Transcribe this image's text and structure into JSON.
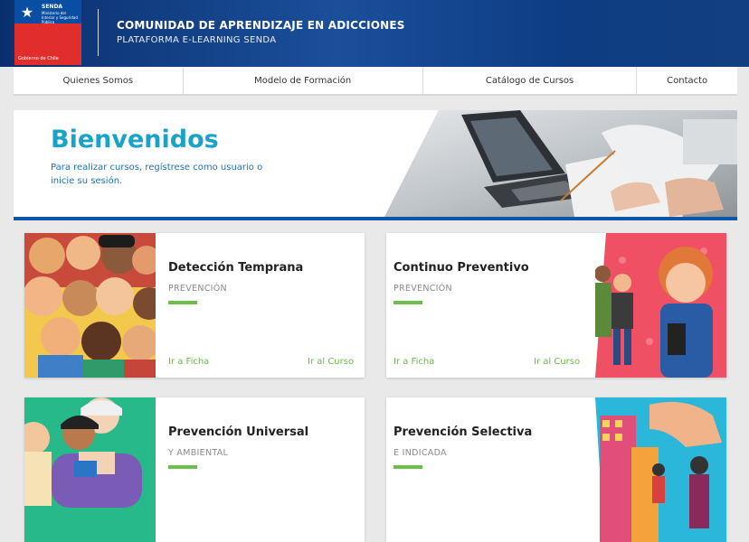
{
  "header": {
    "logo": {
      "top": "SENDA",
      "lines": "Ministerio del Interior y Seguridad Pública",
      "bottom": "Gobierno de Chile"
    },
    "title": "COMUNIDAD DE APRENDIZAJE EN ADICCIONES",
    "subtitle": "PLATAFORMA E-LEARNING SENDA"
  },
  "nav": {
    "items": [
      {
        "label": "Quienes Somos"
      },
      {
        "label": "Modelo de Formación"
      },
      {
        "label": "Catálogo de Cursos"
      },
      {
        "label": "Contacto"
      }
    ]
  },
  "banner": {
    "title": "Bienvenidos",
    "text": "Para realizar cursos, regístrese como usuario o inicie su sesión."
  },
  "cards": [
    {
      "title": "Detección Temprana",
      "category": "PREVENCIÓN",
      "link_ficha": "Ir a Ficha",
      "link_curso": "Ir al Curso"
    },
    {
      "title": "Continuo Preventivo",
      "category": "PREVENCIÓN",
      "link_ficha": "Ir a Ficha",
      "link_curso": "Ir al Curso"
    },
    {
      "title": "Prevención Universal",
      "category": "Y AMBIENTAL"
    },
    {
      "title": "Prevención Selectiva",
      "category": "E INDICADA"
    }
  ],
  "colors": {
    "brand_blue": "#0f56a6",
    "accent_cyan": "#1aa3c9",
    "accent_green": "#6cc04a"
  }
}
